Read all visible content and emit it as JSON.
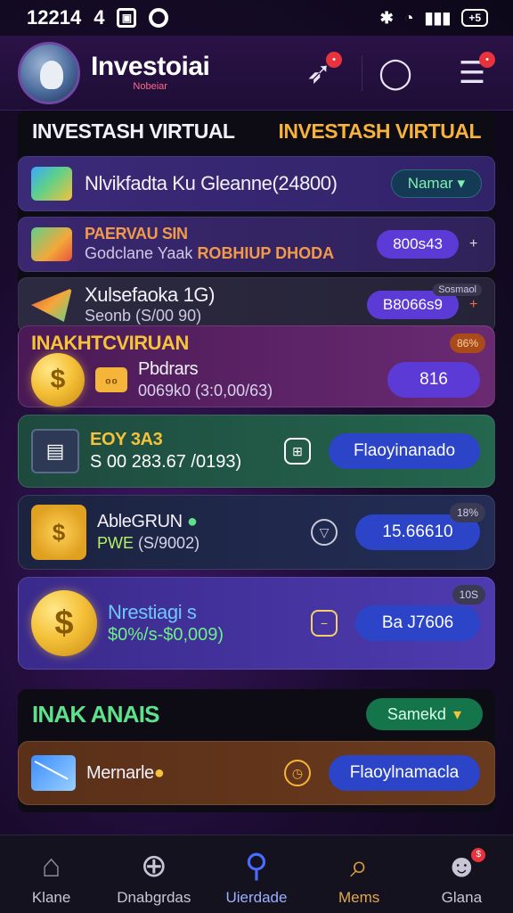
{
  "status_bar": {
    "time": "12214",
    "count": "4",
    "battery": "+5"
  },
  "header": {
    "brand_title": "Investoiai",
    "brand_sub": "Nobeiar"
  },
  "panel_head": {
    "left": "INVESTASH VIRTUAL",
    "right": "INVESTASH VIRTUAL"
  },
  "rows": [
    {
      "title": "Nlvikfadta Ku Gleanne(24800)",
      "button": "Namar"
    },
    {
      "title": "PAERVAU SIN",
      "sub": "Godclane Yaak",
      "sub_highlight": "ROBHIUP DHODA",
      "button": "800s43",
      "extra": "+"
    },
    {
      "title": "Xulsefaoka 1G)",
      "sub": "Seonb (S/00 90)",
      "button": "B8066s9",
      "extra": "+",
      "badge": "Sosmaol"
    }
  ],
  "section_label": "INAKHTCVIRUAN",
  "cards": [
    {
      "icon_label": "Pbdrars",
      "sub": "0069k0 (3:0,00/63)",
      "button": "816",
      "corner": "86%"
    },
    {
      "title": "EOY 3A3",
      "sub": "S 00 283.67 /0193)",
      "button": "Flaoyinanado"
    },
    {
      "title": "AbleGRUN",
      "sub_prefix": "PWE",
      "sub": "(S/9002)",
      "button": "15.66610",
      "corner": "18%"
    },
    {
      "title": "Nrestiagi s",
      "sub": "$0%/s-$0,009)",
      "button": "Ba J7606",
      "corner": "10S"
    }
  ],
  "panel2": {
    "title": "INAK ANAIS",
    "button": "Samekd",
    "card": {
      "title": "Mernarle",
      "button": "Flaoylnamacla"
    }
  },
  "bottom_nav": [
    {
      "label": "Klane",
      "icon": "home-icon"
    },
    {
      "label": "Dnabgrdas",
      "icon": "plus-circle-icon"
    },
    {
      "label": "Uierdade",
      "icon": "user-icon"
    },
    {
      "label": "Mems",
      "icon": "search-icon"
    },
    {
      "label": "Glana",
      "icon": "profile-icon",
      "badge": "$"
    }
  ],
  "colors": {
    "accent_gold": "#f5c23a",
    "accent_green": "#5fe08a",
    "button_blue": "#2b44c8",
    "button_purple": "#5b3ad6"
  }
}
